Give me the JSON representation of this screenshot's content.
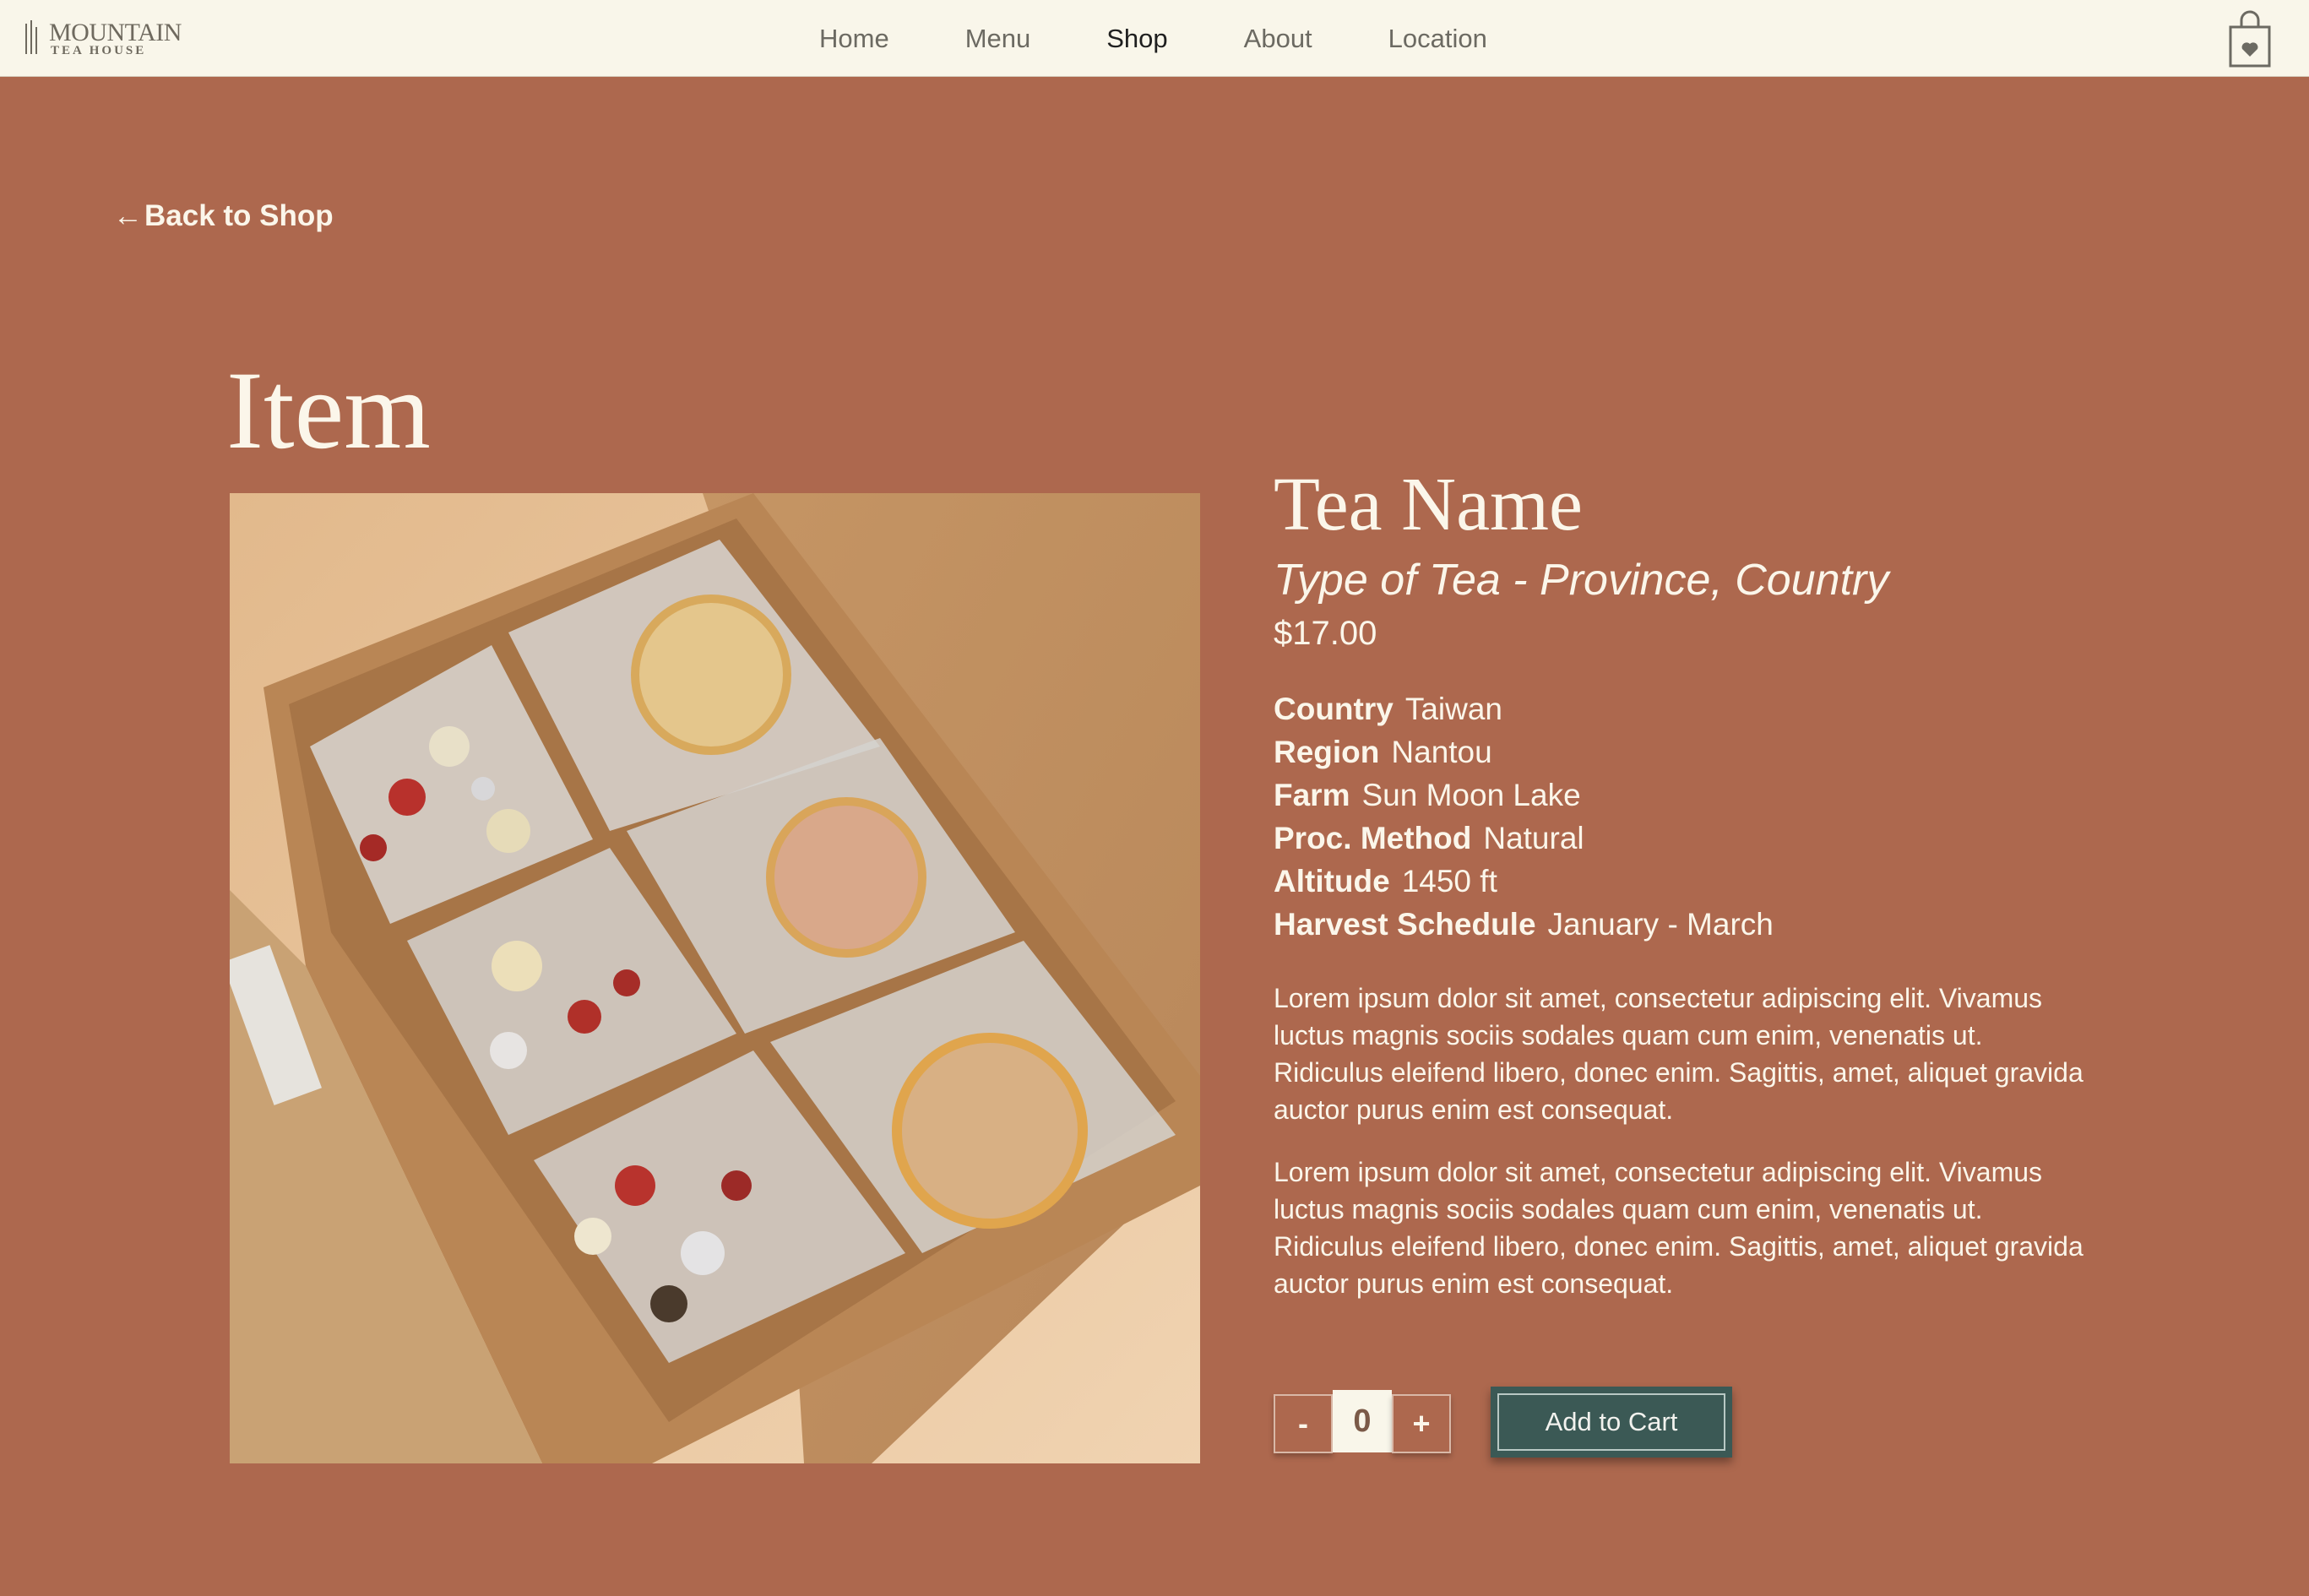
{
  "brand": {
    "name": "MOUNTAIN",
    "subtitle": "TEA HOUSE"
  },
  "nav": {
    "items": [
      {
        "label": "Home",
        "active": false
      },
      {
        "label": "Menu",
        "active": false
      },
      {
        "label": "Shop",
        "active": true
      },
      {
        "label": "About",
        "active": false
      },
      {
        "label": "Location",
        "active": false
      }
    ],
    "cart_icon": "shopping-bag-heart-icon"
  },
  "back_link": {
    "arrow": "←",
    "label": "Back to Shop"
  },
  "page": {
    "title": "Item"
  },
  "product": {
    "name": "Tea Name",
    "type_line": "Type of Tea - Province, Country",
    "price": "$17.00",
    "specs": [
      {
        "key": "Country",
        "value": "Taiwan"
      },
      {
        "key": "Region",
        "value": "Nantou"
      },
      {
        "key": "Farm",
        "value": "Sun Moon Lake"
      },
      {
        "key": "Proc. Method",
        "value": "Natural"
      },
      {
        "key": "Altitude",
        "value": "1450 ft"
      },
      {
        "key": "Harvest Schedule",
        "value": "January - March"
      }
    ],
    "descriptions": [
      "Lorem ipsum dolor sit amet, consectetur adipiscing elit. Vivamus luctus magnis sociis sodales quam cum enim, venenatis ut. Ridiculus eleifend libero, donec enim. Sagittis, amet, aliquet gravida auctor purus enim est consequat.",
      "Lorem ipsum dolor sit amet, consectetur adipiscing elit. Vivamus luctus magnis sociis sodales quam cum enim, venenatis ut. Ridiculus eleifend libero, donec enim. Sagittis, amet, aliquet gravida auctor purus enim est consequat."
    ]
  },
  "purchase": {
    "decrement_label": "-",
    "quantity": "0",
    "increment_label": "+",
    "add_to_cart_label": "Add to Cart"
  },
  "colors": {
    "background": "#ad684e",
    "nav_background": "#f9f6ea",
    "text_light": "#fbf6ea",
    "button_green": "#3b5955"
  }
}
